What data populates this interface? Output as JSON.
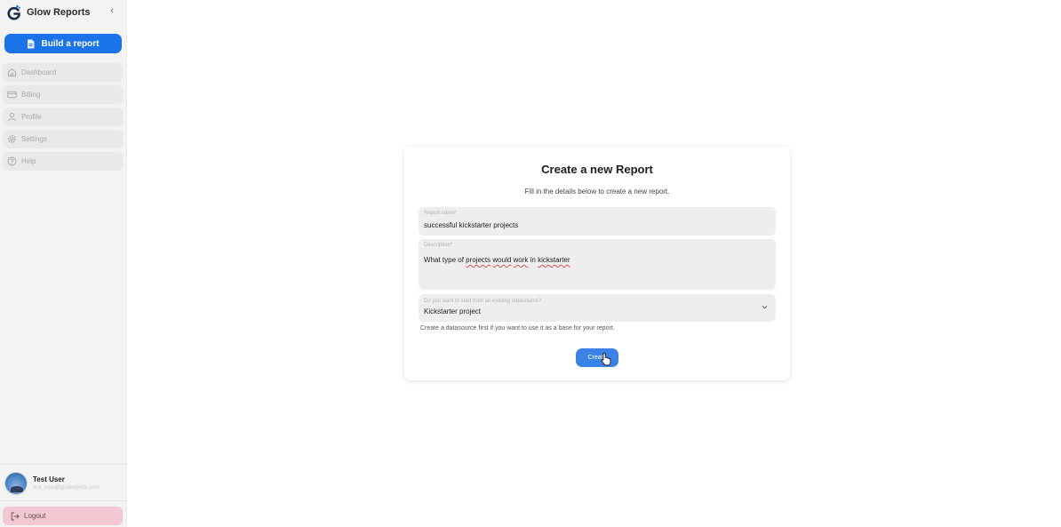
{
  "brand": {
    "name": "Glow Reports",
    "collapse_glyph": "‹"
  },
  "sidebar": {
    "build_button_label": "Build a report",
    "items": [
      {
        "label": "Dashboard",
        "icon": "home-icon"
      },
      {
        "label": "Billing",
        "icon": "credit-card-icon"
      },
      {
        "label": "Profile",
        "icon": "user-icon"
      },
      {
        "label": "Settings",
        "icon": "gear-icon"
      },
      {
        "label": "Help",
        "icon": "help-circle-icon"
      }
    ]
  },
  "user": {
    "name": "Test User",
    "email": "test_user@glowreports.com"
  },
  "logout": {
    "label": "Logout"
  },
  "colors": {
    "accent": "#1a73e8",
    "sidebar_bg": "#f3f3f3",
    "logout_bg": "#f2c9d3"
  },
  "form": {
    "title": "Create a new Report",
    "subtitle": "Fill in the details below to create a new report.",
    "report_name": {
      "label": "Report name*",
      "value": "successful kickstarter projects"
    },
    "description": {
      "label": "Description*",
      "value_parts": [
        "What type of ",
        "projects",
        " ",
        "would",
        " ",
        "work",
        " in ",
        "kickstarter"
      ]
    },
    "datasource": {
      "label": "Do you want to start from an existing datasource?",
      "value": "Kickstarter project"
    },
    "helper_text": "Create a datasource first if you want to use it as a base for your report.",
    "create_label": "Create"
  }
}
